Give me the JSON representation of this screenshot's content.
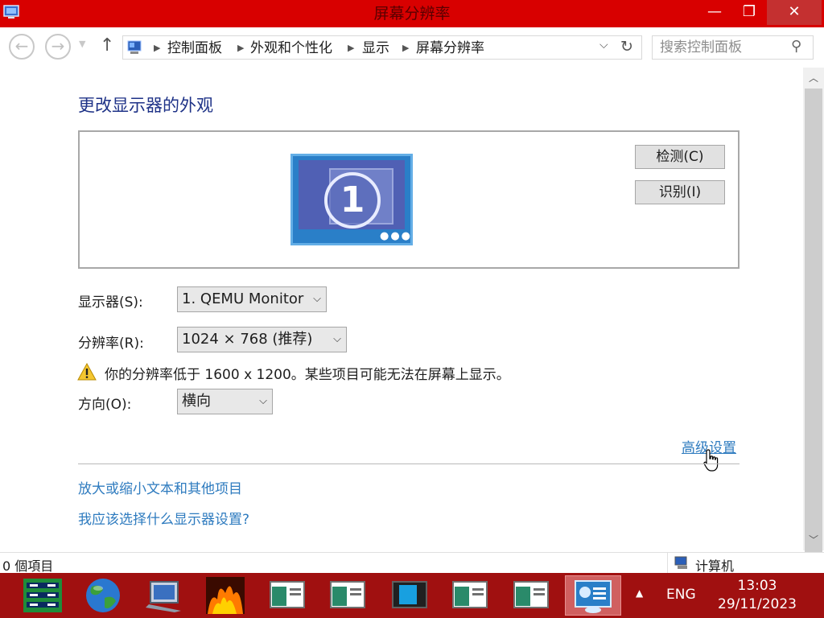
{
  "window": {
    "title": "屏幕分辨率",
    "controls": {
      "minimize": "—",
      "maximize": "❐",
      "close": "✕"
    }
  },
  "address_bar": {
    "breadcrumbs": [
      "控制面板",
      "外观和个性化",
      "显示",
      "屏幕分辨率"
    ],
    "search_placeholder": "搜索控制面板"
  },
  "main": {
    "title": "更改显示器的外观",
    "monitor_number": "1",
    "detect_button": "检测(C)",
    "identify_button": "识别(I)",
    "fields": {
      "display_label": "显示器(S):",
      "display_value": "1. QEMU Monitor",
      "resolution_label": "分辨率(R):",
      "resolution_value": "1024 × 768 (推荐)",
      "orientation_label": "方向(O):",
      "orientation_value": "横向"
    },
    "warning_text": "你的分辨率低于 1600 x 1200。某些项目可能无法在屏幕上显示。",
    "advanced_link": "高级设置",
    "links": {
      "text_size": "放大或缩小文本和其他项目",
      "help": "我应该选择什么显示器设置?"
    }
  },
  "status_bar": {
    "item_count": "0 個項目",
    "location": "计算机"
  },
  "taskbar": {
    "apps": [
      {
        "icon": "network-panel-icon",
        "active": false
      },
      {
        "icon": "globe-icon",
        "active": false
      },
      {
        "icon": "computer-icon",
        "active": false
      },
      {
        "icon": "fire-game-icon",
        "active": false
      },
      {
        "icon": "window-icon",
        "active": false
      },
      {
        "icon": "window-icon",
        "active": false
      },
      {
        "icon": "dark-window-icon",
        "active": false
      },
      {
        "icon": "window-icon",
        "active": false
      },
      {
        "icon": "window-icon",
        "active": false
      },
      {
        "icon": "display-settings-icon",
        "active": true
      }
    ],
    "language": "ENG",
    "time": "13:03",
    "date": "29/11/2023"
  },
  "colors": {
    "titlebar": "#d80000",
    "taskbar": "#a01010",
    "heading": "#1e3287",
    "link": "#2e7bbf",
    "monitor_blue": "#2a7fc8"
  }
}
